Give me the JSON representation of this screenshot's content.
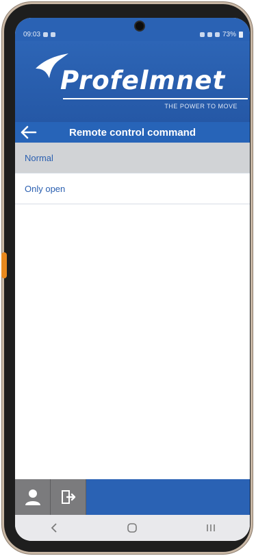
{
  "status_bar": {
    "time": "09:03",
    "battery": "73%"
  },
  "brand": {
    "logo_text": "Profelmnet",
    "tagline": "THE POWER TO MOVE"
  },
  "header": {
    "title": "Remote control command"
  },
  "options": [
    {
      "label": "Normal",
      "selected": true
    },
    {
      "label": "Only open",
      "selected": false
    }
  ],
  "colors": {
    "brand_blue": "#2a62b4",
    "selected_row": "#d1d3d6",
    "option_text": "#2a5fb0"
  }
}
